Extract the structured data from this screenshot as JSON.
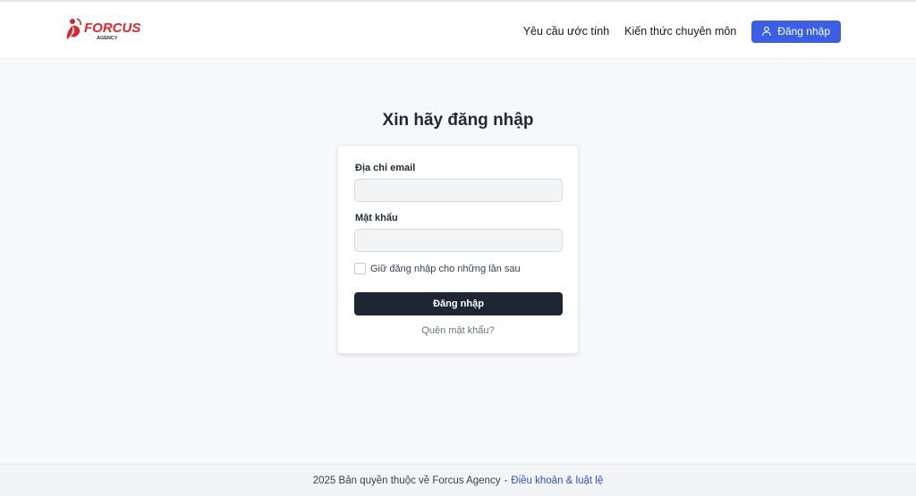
{
  "header": {
    "logo": {
      "brand": "FORCUS",
      "tagline": "AGENCY",
      "color": "#e0252b"
    },
    "nav": {
      "estimate_link": "Yêu cầu ước tính",
      "expertise_link": "Kiến thức chuyên môn",
      "login_button": "Đăng nhập",
      "login_icon": "user-icon"
    }
  },
  "main": {
    "title": "Xin hãy đăng nhập",
    "form": {
      "email_label": "Địa chỉ email",
      "email_value": "",
      "password_label": "Mật khẩu",
      "password_value": "",
      "remember_label": "Giữ đăng nhập cho những lần sau",
      "remember_checked": false,
      "submit_label": "Đăng nhập",
      "forgot_link": "Quên mật khẩu?"
    }
  },
  "footer": {
    "copyright": "2025 Bản quyền thuộc về Forcus Agency",
    "separator": "-",
    "terms_link": "Điều khoản & luật lệ"
  },
  "colors": {
    "accent": "#3b5fe4",
    "submit_bg": "#1f2633",
    "link": "#2f4fd6",
    "page_bg": "#f7f8fb"
  }
}
